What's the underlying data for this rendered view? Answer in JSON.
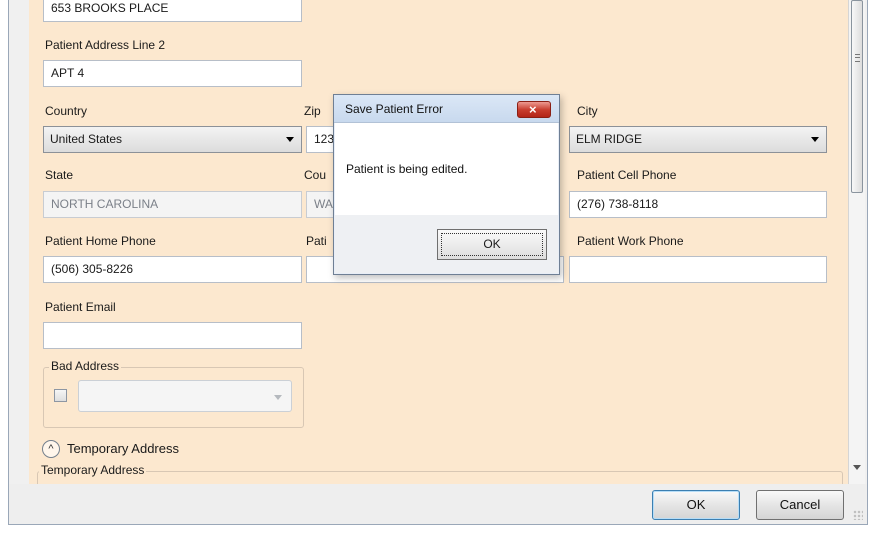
{
  "form": {
    "address_line1_value": "653 BROOKS PLACE",
    "address_line2_label": "Patient Address Line 2",
    "address_line2_value": "APT 4",
    "country_label": "Country",
    "country_value": "United States",
    "zip_label": "Zip",
    "zip_value_partial": "123",
    "city_label": "City",
    "city_value": "ELM RIDGE",
    "state_label": "State",
    "state_value": "NORTH CAROLINA",
    "county_label_partial": "Cou",
    "county_value_partial": "WA",
    "cell_phone_label": "Patient Cell Phone",
    "cell_phone_value": "(276) 738-8118",
    "home_phone_label": "Patient Home Phone",
    "home_phone_value": "(506) 305-8226",
    "middle_phone_label_partial": "Pati",
    "work_phone_label": "Patient Work Phone",
    "work_phone_value": "",
    "email_label": "Patient Email",
    "email_value": "",
    "bad_address_title": "Bad Address",
    "temporary_address_toggle": "Temporary Address",
    "temporary_address_group": "Temporary Address"
  },
  "dialog": {
    "title": "Save Patient Error",
    "message": "Patient is being edited.",
    "ok_label": "OK",
    "close_label": "×"
  },
  "footer": {
    "ok_label": "OK",
    "cancel_label": "Cancel"
  },
  "icons": {
    "collapse": "chevron-up-icon",
    "dropdown": "chevron-down-icon",
    "close": "close-icon"
  },
  "colors": {
    "form_background": "#fce8cf",
    "dialog_close": "#c83d2e",
    "accent_border": "#3c7fb1"
  }
}
